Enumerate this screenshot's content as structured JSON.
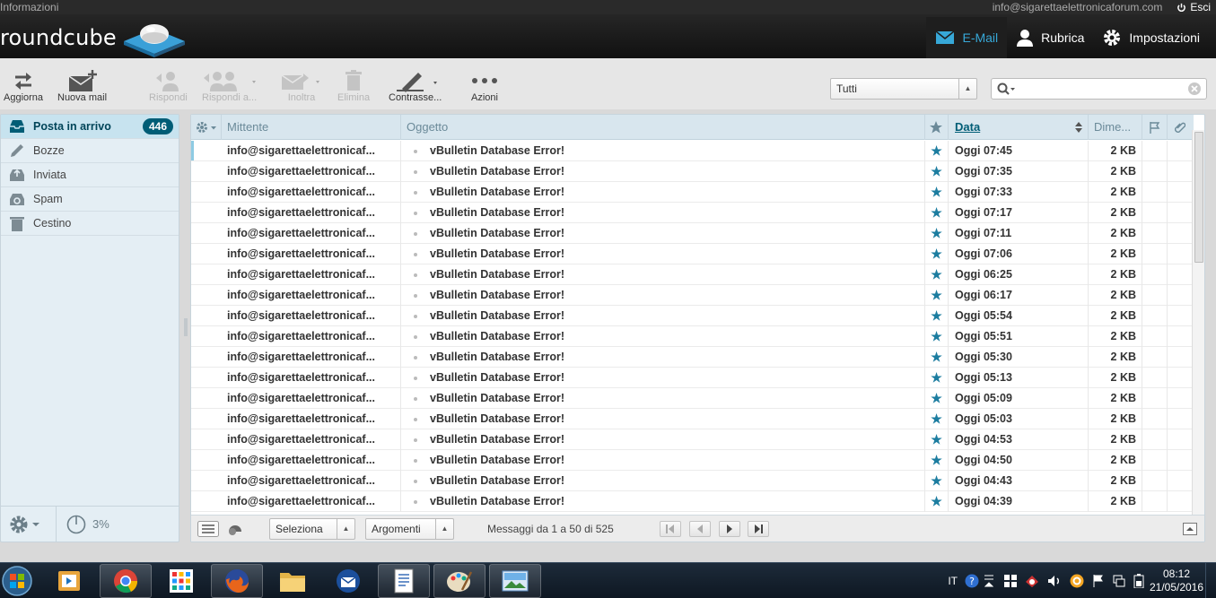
{
  "topline": {
    "info_label": "Informazioni",
    "user_email": "info@sigarettaelettronicaforum.com",
    "logout_label": "Esci"
  },
  "header": {
    "logo_text": "roundcube",
    "nav": [
      {
        "label": "E-Mail",
        "icon": "envelope-icon",
        "active": true
      },
      {
        "label": "Rubrica",
        "icon": "person-icon",
        "active": false
      },
      {
        "label": "Impostazioni",
        "icon": "gear-icon",
        "active": false
      }
    ]
  },
  "toolbar": {
    "refresh": "Aggiorna",
    "compose": "Nuova mail",
    "reply": "Rispondi",
    "reply_all": "Rispondi a...",
    "forward": "Inoltra",
    "delete": "Elimina",
    "mark": "Contrasse...",
    "more": "Azioni",
    "filter_value": "Tutti",
    "search_placeholder": ""
  },
  "folders": [
    {
      "label": "Posta in arrivo",
      "count": "446",
      "selected": true,
      "icon": "inbox-icon"
    },
    {
      "label": "Bozze",
      "selected": false,
      "icon": "pencil-icon"
    },
    {
      "label": "Inviata",
      "selected": false,
      "icon": "sent-icon"
    },
    {
      "label": "Spam",
      "selected": false,
      "icon": "recycle-icon"
    },
    {
      "label": "Cestino",
      "selected": false,
      "icon": "trash-icon"
    }
  ],
  "quota": "3%",
  "columns": {
    "from": "Mittente",
    "subject": "Oggetto",
    "date": "Data",
    "size": "Dime..."
  },
  "messages": [
    {
      "from": "info@sigarettaelettronicaf...",
      "subject": "vBulletin Database Error!",
      "date": "Oggi 07:45",
      "size": "2 KB"
    },
    {
      "from": "info@sigarettaelettronicaf...",
      "subject": "vBulletin Database Error!",
      "date": "Oggi 07:35",
      "size": "2 KB"
    },
    {
      "from": "info@sigarettaelettronicaf...",
      "subject": "vBulletin Database Error!",
      "date": "Oggi 07:33",
      "size": "2 KB"
    },
    {
      "from": "info@sigarettaelettronicaf...",
      "subject": "vBulletin Database Error!",
      "date": "Oggi 07:17",
      "size": "2 KB"
    },
    {
      "from": "info@sigarettaelettronicaf...",
      "subject": "vBulletin Database Error!",
      "date": "Oggi 07:11",
      "size": "2 KB"
    },
    {
      "from": "info@sigarettaelettronicaf...",
      "subject": "vBulletin Database Error!",
      "date": "Oggi 07:06",
      "size": "2 KB"
    },
    {
      "from": "info@sigarettaelettronicaf...",
      "subject": "vBulletin Database Error!",
      "date": "Oggi 06:25",
      "size": "2 KB"
    },
    {
      "from": "info@sigarettaelettronicaf...",
      "subject": "vBulletin Database Error!",
      "date": "Oggi 06:17",
      "size": "2 KB"
    },
    {
      "from": "info@sigarettaelettronicaf...",
      "subject": "vBulletin Database Error!",
      "date": "Oggi 05:54",
      "size": "2 KB"
    },
    {
      "from": "info@sigarettaelettronicaf...",
      "subject": "vBulletin Database Error!",
      "date": "Oggi 05:51",
      "size": "2 KB"
    },
    {
      "from": "info@sigarettaelettronicaf...",
      "subject": "vBulletin Database Error!",
      "date": "Oggi 05:30",
      "size": "2 KB"
    },
    {
      "from": "info@sigarettaelettronicaf...",
      "subject": "vBulletin Database Error!",
      "date": "Oggi 05:13",
      "size": "2 KB"
    },
    {
      "from": "info@sigarettaelettronicaf...",
      "subject": "vBulletin Database Error!",
      "date": "Oggi 05:09",
      "size": "2 KB"
    },
    {
      "from": "info@sigarettaelettronicaf...",
      "subject": "vBulletin Database Error!",
      "date": "Oggi 05:03",
      "size": "2 KB"
    },
    {
      "from": "info@sigarettaelettronicaf...",
      "subject": "vBulletin Database Error!",
      "date": "Oggi 04:53",
      "size": "2 KB"
    },
    {
      "from": "info@sigarettaelettronicaf...",
      "subject": "vBulletin Database Error!",
      "date": "Oggi 04:50",
      "size": "2 KB"
    },
    {
      "from": "info@sigarettaelettronicaf...",
      "subject": "vBulletin Database Error!",
      "date": "Oggi 04:43",
      "size": "2 KB"
    },
    {
      "from": "info@sigarettaelettronicaf...",
      "subject": "vBulletin Database Error!",
      "date": "Oggi 04:39",
      "size": "2 KB"
    }
  ],
  "footer": {
    "select_label": "Seleziona",
    "threads_label": "Argomenti",
    "count_text": "Messaggi da 1 a 50 di 525"
  },
  "taskbar": {
    "apps": [
      "start-orb-icon",
      "media-player-icon",
      "chrome-icon",
      "apps-grid-icon",
      "firefox-icon",
      "folder-icon",
      "thunderbird-icon",
      "document-icon",
      "paint-icon",
      "picture-viewer-icon"
    ],
    "language": "IT",
    "time": "08:12",
    "date": "21/05/2016"
  },
  "colors": {
    "accent": "#37a8d8",
    "badge": "#005d76",
    "star": "#1c7da0"
  }
}
